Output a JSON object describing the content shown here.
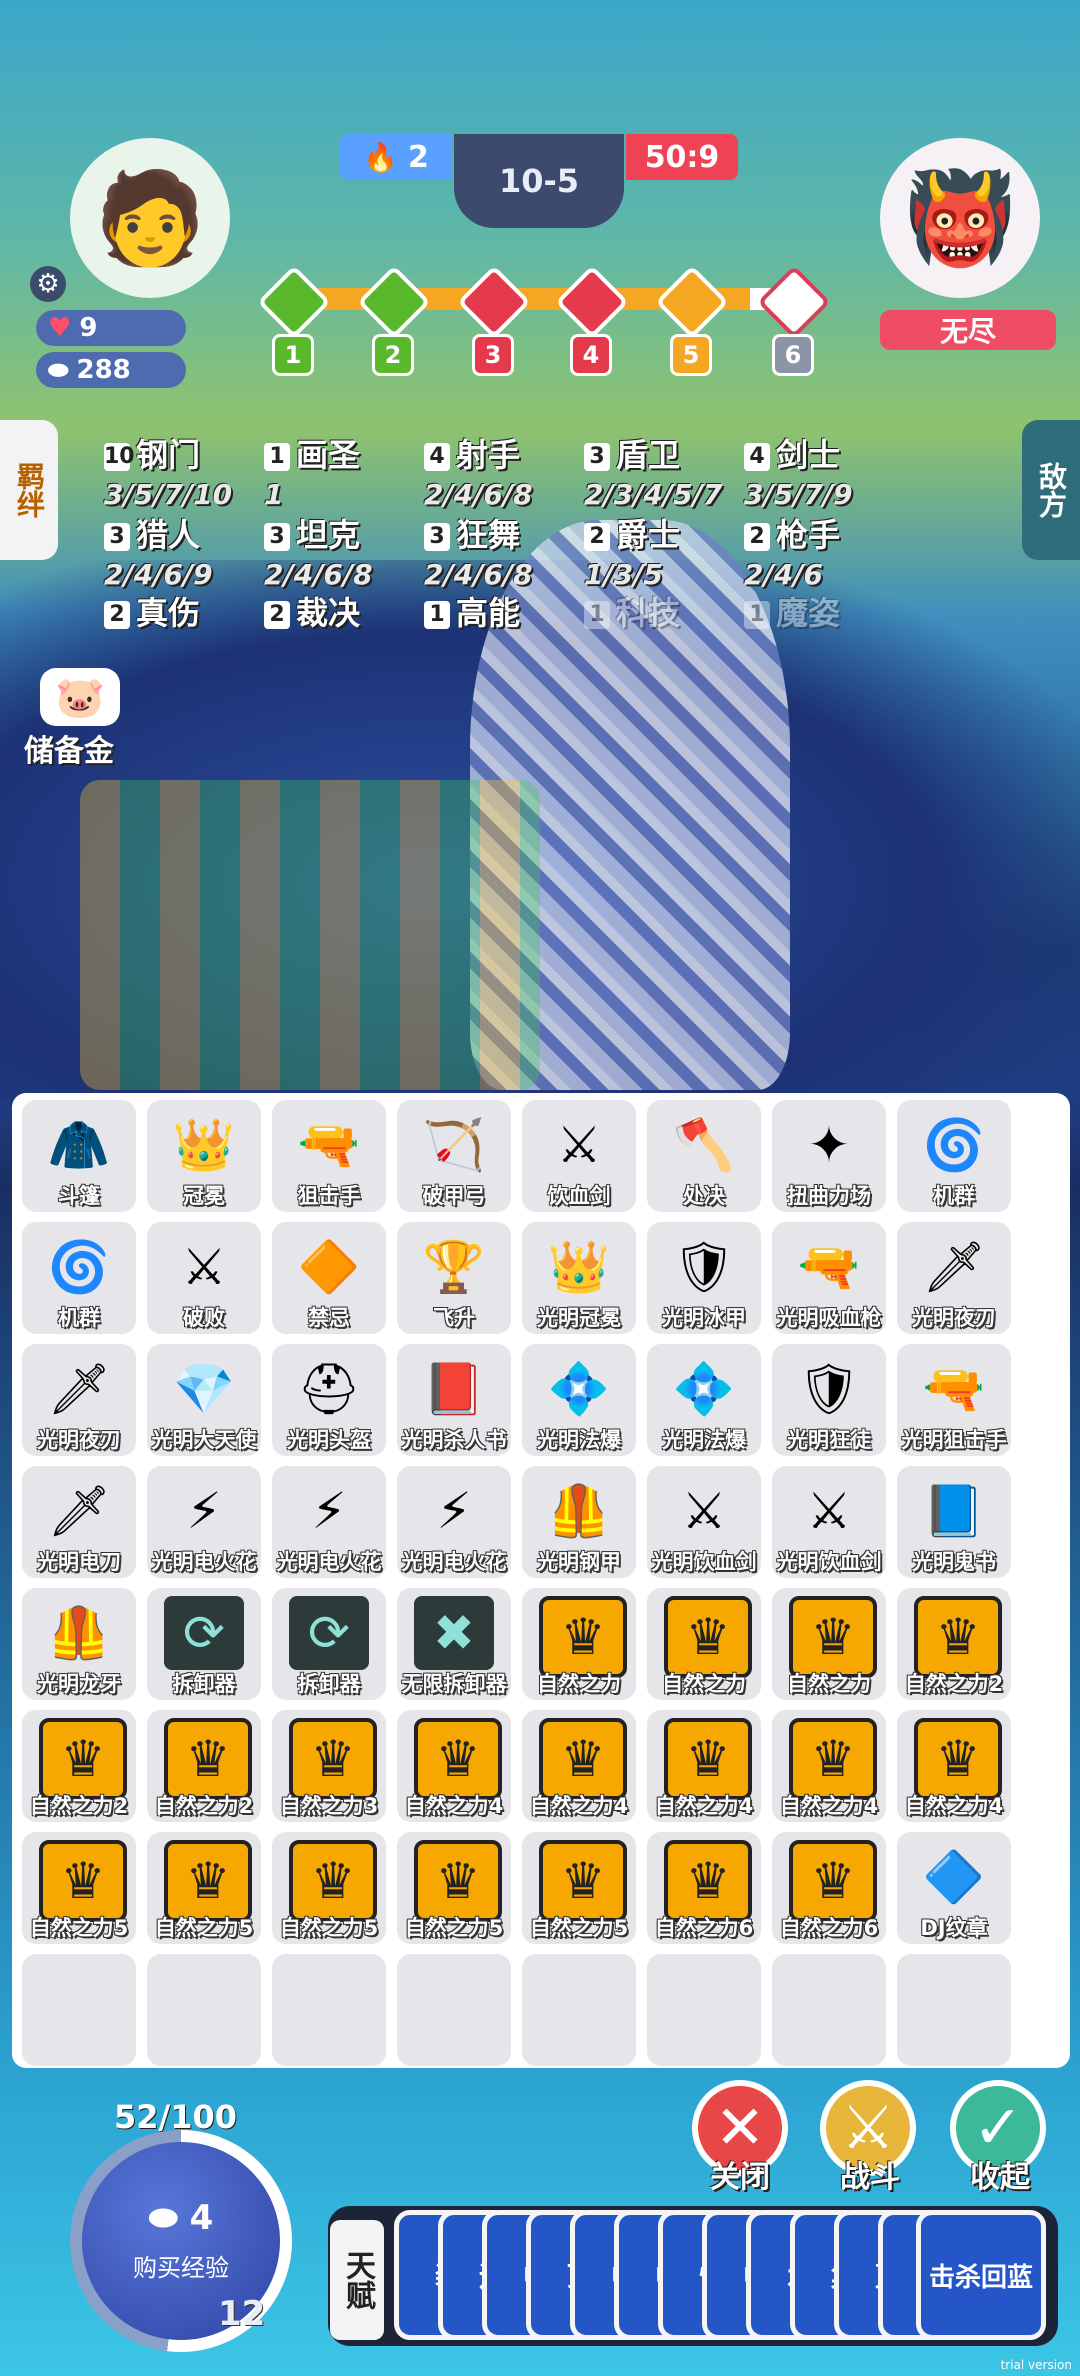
{
  "hud": {
    "lives": "2",
    "stage": "10-5",
    "timer": "50:9",
    "health": "9",
    "gold": "288",
    "enemy_name": "无尽",
    "progress_steps": [
      "1",
      "2",
      "3",
      "4",
      "5",
      "6"
    ],
    "progress_colors": [
      "#5ab82c",
      "#5ab82c",
      "#e53a4b",
      "#e53a4b",
      "#f5a623",
      "#ffffff"
    ]
  },
  "side_tabs": {
    "left": "羁绊",
    "right": "敌方"
  },
  "savings_label": "储备金",
  "traits": [
    {
      "count": "10",
      "name": "钢门",
      "tiers": "3/5/7/10"
    },
    {
      "count": "1",
      "name": "画圣",
      "tiers": "1"
    },
    {
      "count": "4",
      "name": "射手",
      "tiers": "2/4/6/8"
    },
    {
      "count": "3",
      "name": "盾卫",
      "tiers": "2/3/4/5/7"
    },
    {
      "count": "4",
      "name": "剑士",
      "tiers": "3/5/7/9"
    },
    {
      "count": "3",
      "name": "猎人",
      "tiers": "2/4/6/9"
    },
    {
      "count": "3",
      "name": "坦克",
      "tiers": "2/4/6/8"
    },
    {
      "count": "3",
      "name": "狂舞",
      "tiers": "2/4/6/8"
    },
    {
      "count": "2",
      "name": "爵士",
      "tiers": "1/3/5"
    },
    {
      "count": "2",
      "name": "枪手",
      "tiers": "2/4/6"
    },
    {
      "count": "2",
      "name": "真伤",
      "tiers": ""
    },
    {
      "count": "2",
      "name": "裁决",
      "tiers": ""
    },
    {
      "count": "1",
      "name": "高能",
      "tiers": ""
    },
    {
      "count": "1",
      "name": "科技",
      "tiers": ""
    },
    {
      "count": "1",
      "name": "魔姿",
      "tiers": ""
    }
  ],
  "inventory": [
    {
      "label": "斗篷",
      "icon": "🧥",
      "style": "item"
    },
    {
      "label": "冠冕",
      "icon": "👑",
      "style": "item"
    },
    {
      "label": "狙击手",
      "icon": "🔫",
      "style": "item"
    },
    {
      "label": "破甲弓",
      "icon": "🏹",
      "style": "item"
    },
    {
      "label": "饮血剑",
      "icon": "⚔",
      "style": "item"
    },
    {
      "label": "处决",
      "icon": "🪓",
      "style": "item"
    },
    {
      "label": "扭曲力场",
      "icon": "✦",
      "style": "item"
    },
    {
      "label": "机群",
      "icon": "🌀",
      "style": "item"
    },
    {
      "label": "机群",
      "icon": "🌀",
      "style": "item"
    },
    {
      "label": "破败",
      "icon": "⚔",
      "style": "item"
    },
    {
      "label": "禁忌",
      "icon": "🔶",
      "style": "item"
    },
    {
      "label": "飞升",
      "icon": "🏆",
      "style": "item"
    },
    {
      "label": "光明冠冕",
      "icon": "👑",
      "style": "item"
    },
    {
      "label": "光明冰甲",
      "icon": "🛡",
      "style": "item"
    },
    {
      "label": "光明吸血枪",
      "icon": "🔫",
      "style": "item"
    },
    {
      "label": "光明夜刃",
      "icon": "🗡",
      "style": "item"
    },
    {
      "label": "光明夜刃",
      "icon": "🗡",
      "style": "item"
    },
    {
      "label": "光明大天使",
      "icon": "💎",
      "style": "item"
    },
    {
      "label": "光明头盔",
      "icon": "⛑",
      "style": "item"
    },
    {
      "label": "光明杀人书",
      "icon": "📕",
      "style": "item"
    },
    {
      "label": "光明法爆",
      "icon": "💠",
      "style": "item"
    },
    {
      "label": "光明法爆",
      "icon": "💠",
      "style": "item"
    },
    {
      "label": "光明狂徒",
      "icon": "🛡",
      "style": "item"
    },
    {
      "label": "光明狙击手",
      "icon": "🔫",
      "style": "item"
    },
    {
      "label": "光明电刀",
      "icon": "🗡",
      "style": "item"
    },
    {
      "label": "光明电火花",
      "icon": "⚡",
      "style": "item"
    },
    {
      "label": "光明电火花",
      "icon": "⚡",
      "style": "item"
    },
    {
      "label": "光明电火花",
      "icon": "⚡",
      "style": "item"
    },
    {
      "label": "光明钢甲",
      "icon": "🦺",
      "style": "item"
    },
    {
      "label": "光明饮血剑",
      "icon": "⚔",
      "style": "item"
    },
    {
      "label": "光明饮血剑",
      "icon": "⚔",
      "style": "item"
    },
    {
      "label": "光明鬼书",
      "icon": "📘",
      "style": "item"
    },
    {
      "label": "光明龙牙",
      "icon": "🦺",
      "style": "item"
    },
    {
      "label": "拆卸器",
      "icon": "⟳",
      "style": "tool"
    },
    {
      "label": "拆卸器",
      "icon": "⟳",
      "style": "tool"
    },
    {
      "label": "无限拆卸器",
      "icon": "✖",
      "style": "tool"
    },
    {
      "label": "自然之力",
      "icon": "♛",
      "style": "crown"
    },
    {
      "label": "自然之力",
      "icon": "♛",
      "style": "crown"
    },
    {
      "label": "自然之力",
      "icon": "♛",
      "style": "crown"
    },
    {
      "label": "自然之力2",
      "icon": "♛",
      "style": "crown"
    },
    {
      "label": "自然之力2",
      "icon": "♛",
      "style": "crown"
    },
    {
      "label": "自然之力2",
      "icon": "♛",
      "style": "crown"
    },
    {
      "label": "自然之力3",
      "icon": "♛",
      "style": "crown"
    },
    {
      "label": "自然之力4",
      "icon": "♛",
      "style": "crown"
    },
    {
      "label": "自然之力4",
      "icon": "♛",
      "style": "crown"
    },
    {
      "label": "自然之力4",
      "icon": "♛",
      "style": "crown"
    },
    {
      "label": "自然之力4",
      "icon": "♛",
      "style": "crown"
    },
    {
      "label": "自然之力4",
      "icon": "♛",
      "style": "crown"
    },
    {
      "label": "自然之力5",
      "icon": "♛",
      "style": "crown"
    },
    {
      "label": "自然之力5",
      "icon": "♛",
      "style": "crown"
    },
    {
      "label": "自然之力5",
      "icon": "♛",
      "style": "crown"
    },
    {
      "label": "自然之力5",
      "icon": "♛",
      "style": "crown"
    },
    {
      "label": "自然之力5",
      "icon": "♛",
      "style": "crown"
    },
    {
      "label": "自然之力6",
      "icon": "♛",
      "style": "crown"
    },
    {
      "label": "自然之力6",
      "icon": "♛",
      "style": "crown"
    },
    {
      "label": "DJ纹章",
      "icon": "🔷",
      "style": "item"
    },
    {
      "label": "",
      "icon": "",
      "style": "empty"
    },
    {
      "label": "",
      "icon": "",
      "style": "empty"
    },
    {
      "label": "",
      "icon": "",
      "style": "empty"
    },
    {
      "label": "",
      "icon": "",
      "style": "empty"
    },
    {
      "label": "",
      "icon": "",
      "style": "empty"
    },
    {
      "label": "",
      "icon": "",
      "style": "empty"
    },
    {
      "label": "",
      "icon": "",
      "style": "empty"
    },
    {
      "label": "",
      "icon": "",
      "style": "empty"
    }
  ],
  "buttons": {
    "close": "关闭",
    "battle": "战斗",
    "collapse": "收起"
  },
  "experience": {
    "progress": "52/100",
    "cost": "4",
    "buy_label": "购买经验",
    "level": "12"
  },
  "talent": {
    "header": "天赋",
    "cards": [
      "装",
      "运",
      "中",
      "顶",
      "中",
      "中",
      "恢",
      "中",
      "水",
      "集",
      "蓝",
      "金",
      "击杀回蓝"
    ]
  },
  "watermark": "trial version"
}
